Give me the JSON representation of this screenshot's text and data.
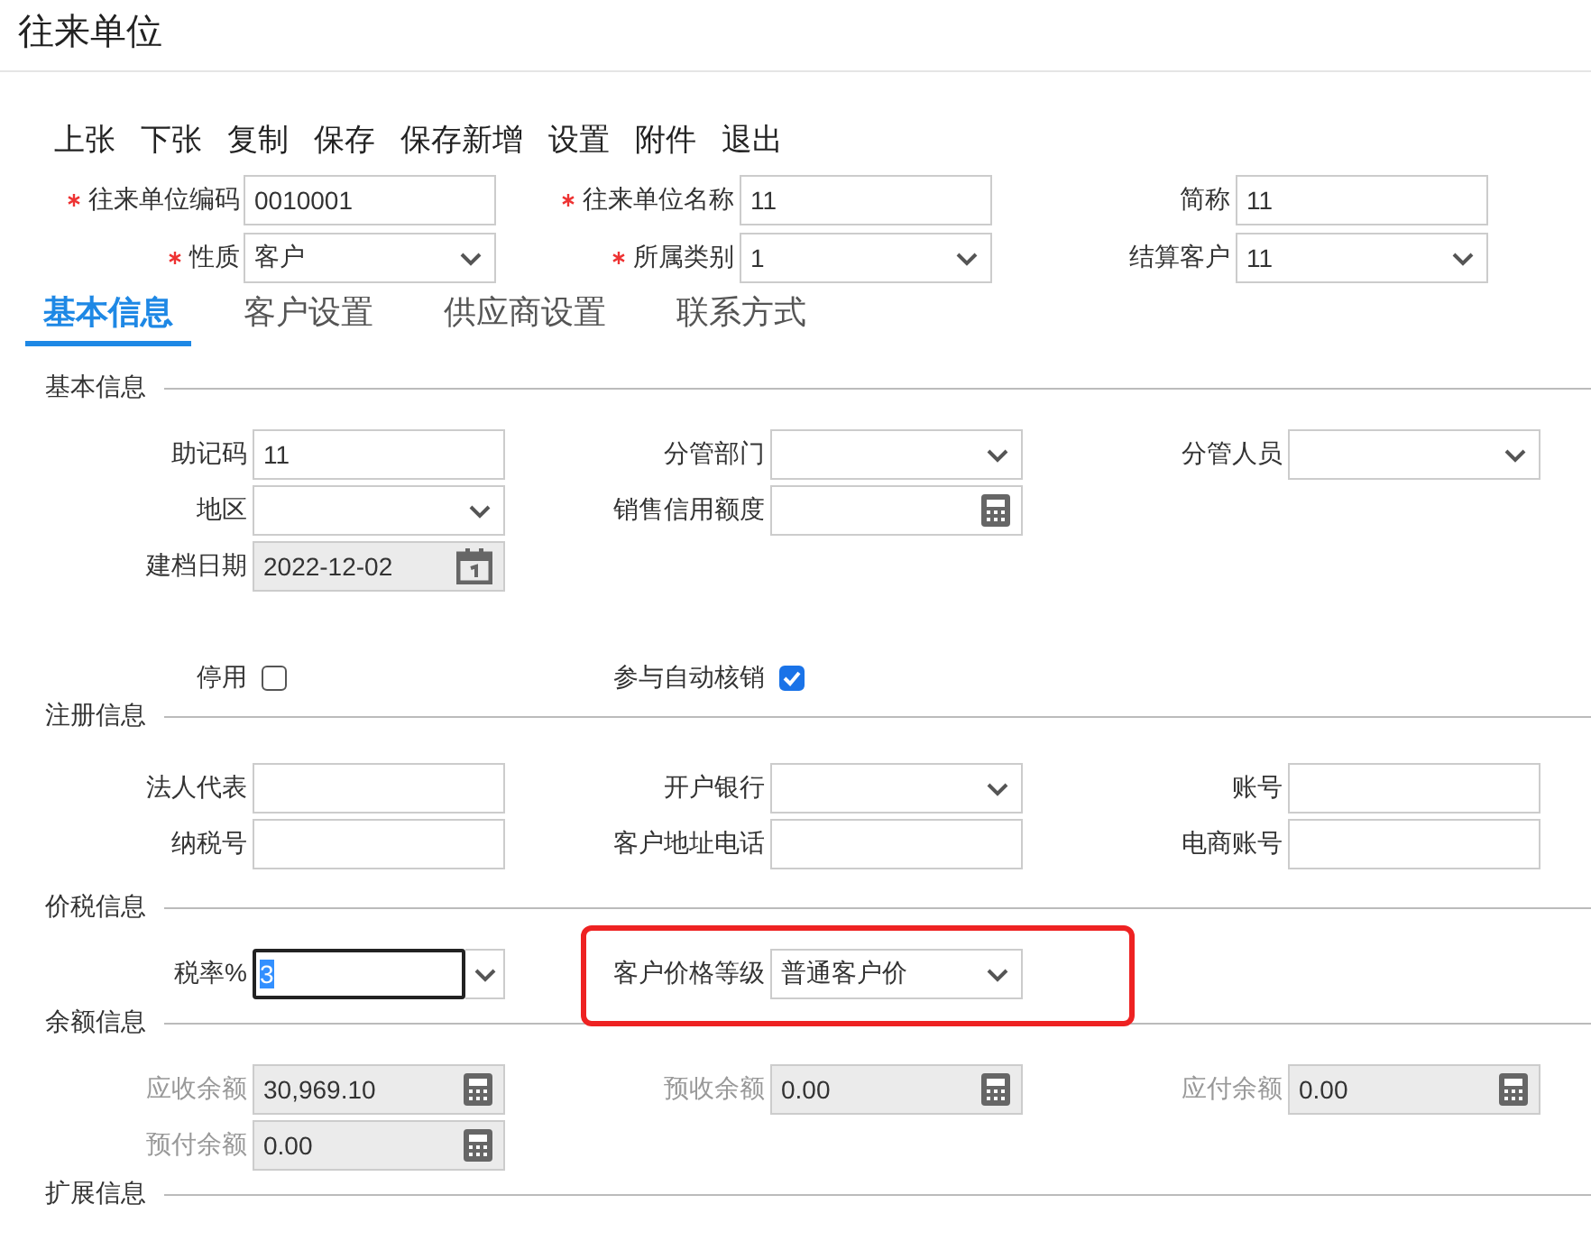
{
  "title": "往来单位",
  "toolbar": [
    "上张",
    "下张",
    "复制",
    "保存",
    "保存新增",
    "设置",
    "附件",
    "退出"
  ],
  "header_rows": [
    [
      {
        "label": "往来单位编码",
        "kind": "text",
        "required": true,
        "value": "0010001"
      },
      {
        "label": "往来单位名称",
        "kind": "text",
        "required": true,
        "value": "11"
      },
      {
        "label": "简称",
        "kind": "text",
        "required": false,
        "value": "11"
      }
    ],
    [
      {
        "label": "性质",
        "kind": "select",
        "required": true,
        "value": "客户"
      },
      {
        "label": "所属类别",
        "kind": "select",
        "required": true,
        "value": "1"
      },
      {
        "label": "结算客户",
        "kind": "select",
        "required": false,
        "value": "11"
      }
    ]
  ],
  "tabs": [
    {
      "label": "基本信息",
      "selected": true
    },
    {
      "label": "客户设置",
      "selected": false
    },
    {
      "label": "供应商设置",
      "selected": false
    },
    {
      "label": "联系方式",
      "selected": false
    }
  ],
  "sections": [
    {
      "title": "基本信息",
      "rows": [
        [
          {
            "label": "助记码",
            "kind": "text",
            "value": "11"
          },
          {
            "label": "分管部门",
            "kind": "select"
          },
          {
            "label": "分管人员",
            "kind": "select"
          }
        ],
        [
          {
            "label": "地区",
            "kind": "select"
          },
          {
            "label": "销售信用额度",
            "kind": "calc"
          }
        ],
        [
          {
            "label": "建档日期",
            "kind": "date",
            "value": "2022-12-02",
            "readonly": true
          }
        ],
        [
          {
            "label": "停用",
            "kind": "checkbox",
            "checked": false
          },
          {
            "label": "参与自动核销",
            "kind": "checkbox",
            "checked": true
          }
        ]
      ]
    },
    {
      "title": "注册信息",
      "rows": [
        [
          {
            "label": "法人代表",
            "kind": "text"
          },
          {
            "label": "开户银行",
            "kind": "select"
          },
          {
            "label": "账号",
            "kind": "text"
          }
        ],
        [
          {
            "label": "纳税号",
            "kind": "text"
          },
          {
            "label": "客户地址电话",
            "kind": "text"
          },
          {
            "label": "电商账号",
            "kind": "text"
          }
        ]
      ]
    },
    {
      "title": "价税信息",
      "rows": [
        [
          {
            "label": "税率%",
            "kind": "combo",
            "value": "3",
            "focused": true
          },
          {
            "label": "客户价格等级",
            "kind": "select",
            "value": "普通客户价",
            "highlighted": true
          }
        ]
      ]
    },
    {
      "title": "余额信息",
      "rows": [
        [
          {
            "label": "应收余额",
            "kind": "calc",
            "value": "30,969.10",
            "disabled": true
          },
          {
            "label": "预收余额",
            "kind": "calc",
            "value": "0.00",
            "disabled": true
          },
          {
            "label": "应付余额",
            "kind": "calc",
            "value": "0.00",
            "disabled": true
          }
        ],
        [
          {
            "label": "预付余额",
            "kind": "calc",
            "value": "0.00",
            "disabled": true
          }
        ]
      ]
    },
    {
      "title": "扩展信息"
    }
  ]
}
